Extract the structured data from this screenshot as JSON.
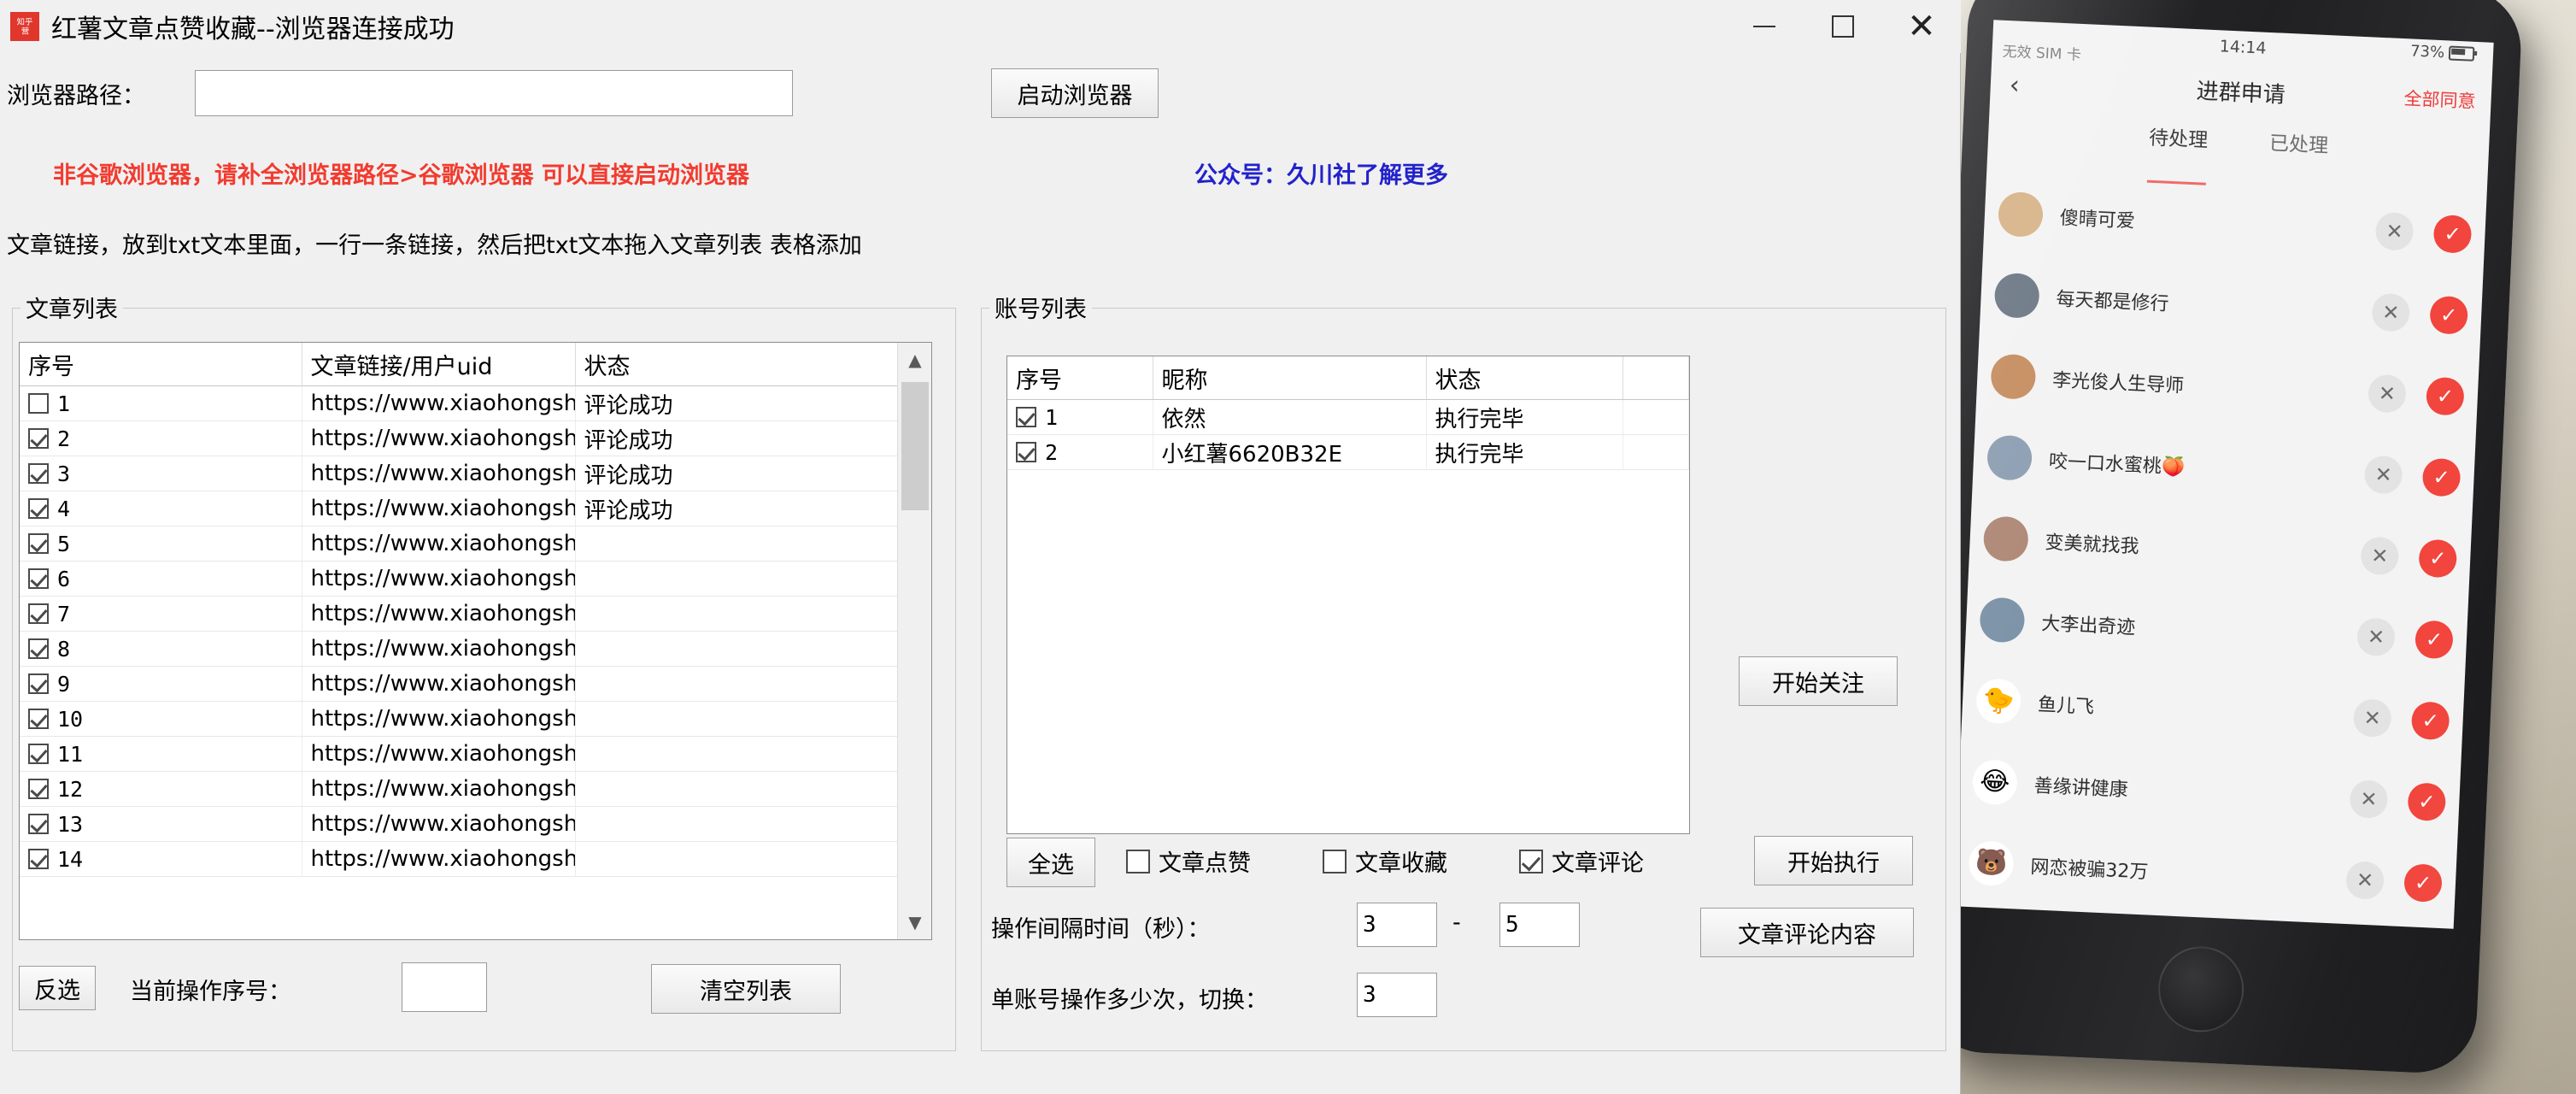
{
  "window": {
    "title": "红薯文章点赞收藏--浏览器连接成功",
    "icon_text_top": "知乎",
    "icon_text_bottom": "营",
    "minimize_label": "",
    "maximize_label": "",
    "close_label": "✕"
  },
  "browser_path": {
    "label": "浏览器路径：",
    "value": "",
    "placeholder": "",
    "launch_button": "启动浏览器"
  },
  "notices": {
    "warning_red": "非谷歌浏览器，请补全浏览器路径>谷歌浏览器 可以直接启动浏览器",
    "warning_color": "#f23b2f",
    "blue_note": "公众号：久川社了解更多",
    "blue_color": "#2222cc",
    "howto": "文章链接，放到txt文本里面，一行一条链接，然后把txt文本拖入文章列表 表格添加"
  },
  "article_panel": {
    "legend": "文章列表",
    "columns": [
      "序号",
      "文章链接/用户uid",
      "状态"
    ],
    "rows": [
      {
        "checked": false,
        "index": "1",
        "url": "https://www.xiaohongshu.co...",
        "status": "评论成功"
      },
      {
        "checked": true,
        "index": "2",
        "url": "https://www.xiaohongshu.co...",
        "status": "评论成功"
      },
      {
        "checked": true,
        "index": "3",
        "url": "https://www.xiaohongshu.co...",
        "status": "评论成功"
      },
      {
        "checked": true,
        "index": "4",
        "url": "https://www.xiaohongshu.co...",
        "status": "评论成功"
      },
      {
        "checked": true,
        "index": "5",
        "url": "https://www.xiaohongshu.co...",
        "status": ""
      },
      {
        "checked": true,
        "index": "6",
        "url": "https://www.xiaohongshu.co...",
        "status": ""
      },
      {
        "checked": true,
        "index": "7",
        "url": "https://www.xiaohongshu.co...",
        "status": ""
      },
      {
        "checked": true,
        "index": "8",
        "url": "https://www.xiaohongshu.co...",
        "status": ""
      },
      {
        "checked": true,
        "index": "9",
        "url": "https://www.xiaohongshu.co...",
        "status": ""
      },
      {
        "checked": true,
        "index": "10",
        "url": "https://www.xiaohongshu.co...",
        "status": ""
      },
      {
        "checked": true,
        "index": "11",
        "url": "https://www.xiaohongshu.co...",
        "status": ""
      },
      {
        "checked": true,
        "index": "12",
        "url": "https://www.xiaohongshu.co...",
        "status": ""
      },
      {
        "checked": true,
        "index": "13",
        "url": "https://www.xiaohongshu.co...",
        "status": ""
      },
      {
        "checked": true,
        "index": "14",
        "url": "https://www.xiaohongshu.co...",
        "status": ""
      }
    ],
    "scroll_up": "▲",
    "scroll_down": "▼",
    "invert_button": "反选",
    "current_index_label": "当前操作序号：",
    "current_index_value": "",
    "clear_button": "清空列表"
  },
  "account_panel": {
    "legend": "账号列表",
    "columns": [
      "序号",
      "昵称",
      "状态",
      ""
    ],
    "rows": [
      {
        "checked": true,
        "index": "1",
        "nickname": "依然",
        "status": "执行完毕"
      },
      {
        "checked": true,
        "index": "2",
        "nickname": "小红薯6620B32E",
        "status": "执行完毕"
      }
    ],
    "follow_button": "开始关注",
    "select_all_button": "全选",
    "options": [
      {
        "label": "文章点赞",
        "checked": false
      },
      {
        "label": "文章收藏",
        "checked": false
      },
      {
        "label": "文章评论",
        "checked": true
      }
    ],
    "execute_button": "开始执行",
    "comment_content_button": "文章评论内容",
    "interval_label": "操作间隔时间（秒）：",
    "interval_min": "3",
    "interval_dash": "-",
    "interval_max": "5",
    "switch_label": "单账号操作多少次，切换：",
    "switch_value": "3"
  },
  "phone": {
    "status": {
      "carrier": "无效 SIM 卡",
      "wifi_icon": "wifi-icon",
      "time": "14:14",
      "battery": "73%"
    },
    "nav": {
      "back_icon": "chevron-left-icon",
      "title": "进群申请",
      "agree_all": "全部同意",
      "agree_all_color": "#ef3b3b"
    },
    "tabs": [
      {
        "label": "待处理",
        "active": true
      },
      {
        "label": "已处理",
        "active": false
      }
    ],
    "requests": [
      {
        "name": "傻晴可爱",
        "avatar": "photo-avatar",
        "avatar_color": "#d8b48a",
        "emoji": ""
      },
      {
        "name": "每天都是修行",
        "avatar": "photo-avatar",
        "avatar_color": "#6e7a86",
        "emoji": ""
      },
      {
        "name": "李光俊人生导师",
        "avatar": "photo-avatar",
        "avatar_color": "#c78f63",
        "emoji": ""
      },
      {
        "name": "咬一口水蜜桃🍑",
        "avatar": "photo-avatar",
        "avatar_color": "#8fa0b4",
        "emoji": ""
      },
      {
        "name": "变美就找我",
        "avatar": "photo-avatar",
        "avatar_color": "#b08a78",
        "emoji": ""
      },
      {
        "name": "大李出奇迹",
        "avatar": "photo-avatar",
        "avatar_color": "#7e94a8",
        "emoji": ""
      },
      {
        "name": "鱼儿飞",
        "avatar": "emoji-avatar",
        "avatar_color": "#ffffff",
        "emoji": "🐤"
      },
      {
        "name": "善缘讲健康",
        "avatar": "emoji-avatar",
        "avatar_color": "#ffffff",
        "emoji": "😂"
      },
      {
        "name": "网恋被骗32万",
        "avatar": "emoji-avatar",
        "avatar_color": "#ffffff",
        "emoji": "🐻"
      }
    ],
    "reject_icon": "✕",
    "accept_icon": "✓",
    "accept_color": "#f1453d"
  }
}
